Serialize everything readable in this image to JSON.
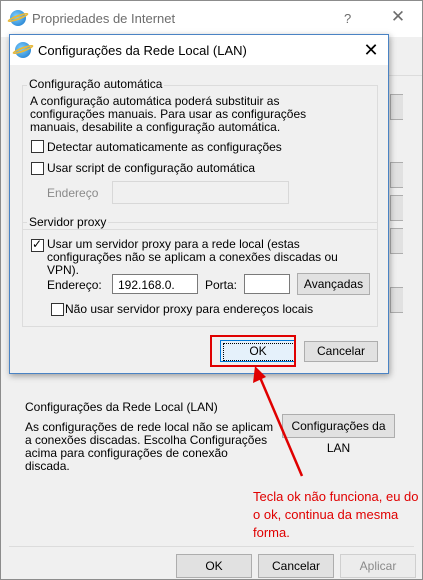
{
  "outer_window": {
    "title": "Propriedades de Internet",
    "help_label": "?",
    "close_label": "✕",
    "lan_section": {
      "title": "Configurações da Rede Local (LAN)",
      "description": "As configurações de rede local não se aplicam a conexões discadas. Escolha Configurações acima para configurações de conexão discada.",
      "button_label": "Configurações da LAN"
    },
    "buttons": {
      "ok": "OK",
      "cancel": "Cancelar",
      "apply": "Aplicar"
    }
  },
  "lan_dialog": {
    "title": "Configurações da Rede Local (LAN)",
    "close_label": "✕",
    "auto_config": {
      "legend": "Configuração automática",
      "description": "A configuração automática poderá substituir as configurações manuais. Para usar as configurações manuais, desabilite a configuração automática.",
      "detect_label": "Detectar automaticamente as configurações",
      "detect_checked": false,
      "script_label": "Usar script de configuração automática",
      "script_checked": false,
      "address_label": "Endereço",
      "address_value": ""
    },
    "proxy": {
      "legend": "Servidor proxy",
      "use_proxy_label": "Usar um servidor proxy para a rede local (estas configurações não se aplicam a conexões discadas ou VPN).",
      "use_proxy_checked": true,
      "address_label": "Endereço:",
      "address_value": "192.168.0.",
      "port_label": "Porta:",
      "port_value": "",
      "advanced_label": "Avançadas",
      "bypass_label": "Não usar servidor proxy para endereços locais",
      "bypass_checked": false
    },
    "buttons": {
      "ok": "OK",
      "cancel": "Cancelar"
    }
  },
  "annotation": {
    "text": "Tecla ok não funciona, eu do o ok, continua da mesma forma.",
    "color": "#e00000"
  }
}
